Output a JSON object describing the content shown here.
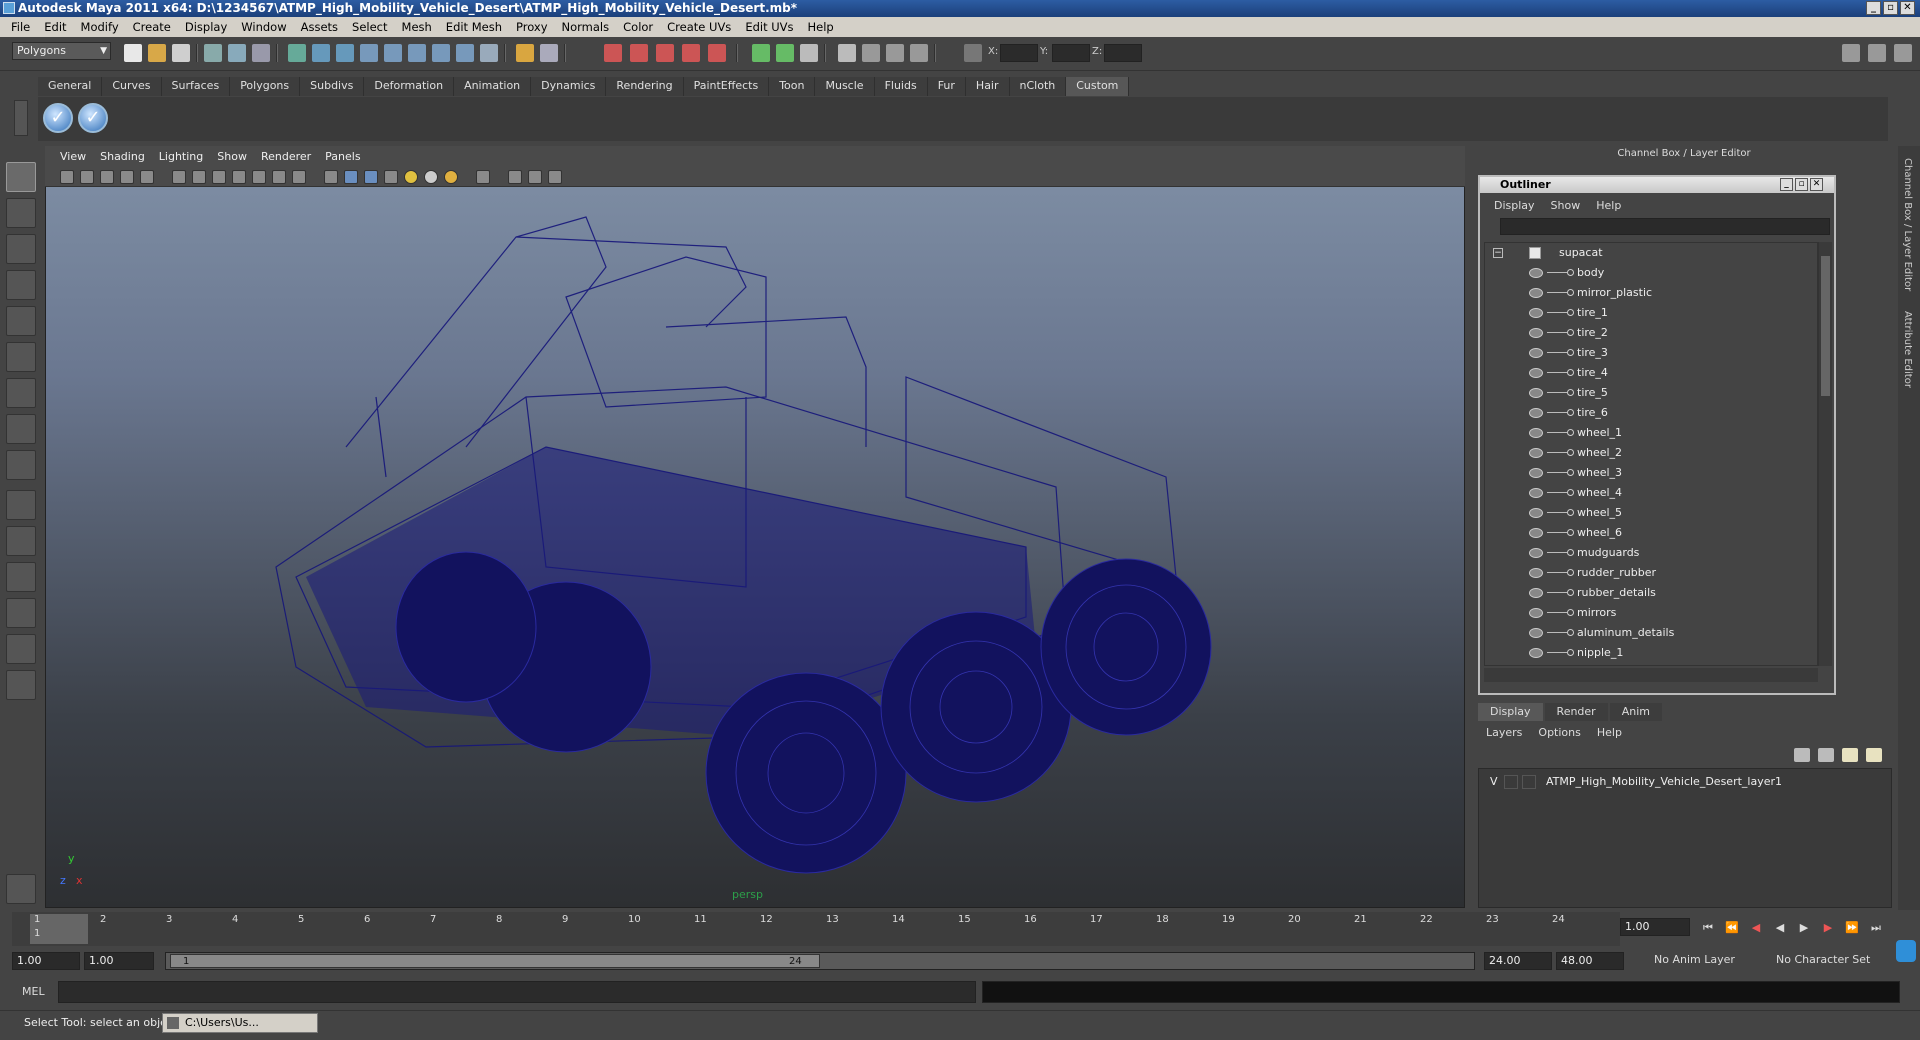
{
  "window": {
    "title": "Autodesk Maya 2011 x64: D:\\1234567\\ATMP_High_Mobility_Vehicle_Desert\\ATMP_High_Mobility_Vehicle_Desert.mb*"
  },
  "menubar": [
    "File",
    "Edit",
    "Modify",
    "Create",
    "Display",
    "Window",
    "Assets",
    "Select",
    "Mesh",
    "Edit Mesh",
    "Proxy",
    "Normals",
    "Color",
    "Create UVs",
    "Edit UVs",
    "Help"
  ],
  "toolbar": {
    "mode": "Polygons",
    "x_label": "X:",
    "y_label": "Y:",
    "z_label": "Z:"
  },
  "shelf": {
    "tabs": [
      "General",
      "Curves",
      "Surfaces",
      "Polygons",
      "Subdivs",
      "Deformation",
      "Animation",
      "Dynamics",
      "Rendering",
      "PaintEffects",
      "Toon",
      "Muscle",
      "Fluids",
      "Fur",
      "Hair",
      "nCloth",
      "Custom"
    ],
    "active": "Custom"
  },
  "viewport": {
    "menu": [
      "View",
      "Shading",
      "Lighting",
      "Show",
      "Renderer",
      "Panels"
    ],
    "camera_label": "persp",
    "axis_y": "y",
    "axis_x": "x",
    "axis_z": "z",
    "wire_color": "#1a1a7a"
  },
  "right_panel": {
    "title": "Channel Box / Layer Editor",
    "side_tabs": [
      "Channel Box / Layer Editor",
      "Attribute Editor"
    ]
  },
  "outliner": {
    "title": "Outliner",
    "menu": [
      "Display",
      "Show",
      "Help"
    ],
    "root": "supacat",
    "items": [
      "body",
      "mirror_plastic",
      "tire_1",
      "tire_2",
      "tire_3",
      "tire_4",
      "tire_5",
      "tire_6",
      "wheel_1",
      "wheel_2",
      "wheel_3",
      "wheel_4",
      "wheel_5",
      "wheel_6",
      "mudguards",
      "rudder_rubber",
      "rubber_details",
      "mirrors",
      "aluminum_details",
      "nipple_1"
    ]
  },
  "layers": {
    "tabs": [
      "Display",
      "Render",
      "Anim"
    ],
    "active_tab": "Display",
    "menu": [
      "Layers",
      "Options",
      "Help"
    ],
    "visible_flag": "V",
    "layer_name": "ATMP_High_Mobility_Vehicle_Desert_layer1"
  },
  "timeline": {
    "ticks": [
      "1",
      "2",
      "3",
      "4",
      "5",
      "6",
      "7",
      "8",
      "9",
      "10",
      "11",
      "12",
      "13",
      "14",
      "15",
      "16",
      "17",
      "18",
      "19",
      "20",
      "21",
      "22",
      "23",
      "24"
    ],
    "current_frame": "1.00",
    "current_marker": "1"
  },
  "range": {
    "start": "1.00",
    "playback_start": "1.00",
    "slider_start": "1",
    "slider_end": "24",
    "playback_end": "24.00",
    "end": "48.00",
    "anim_layer": "No Anim Layer",
    "character_set": "No Character Set"
  },
  "mel": {
    "label": "MEL"
  },
  "status": {
    "help_line": "Select Tool: select an object",
    "minimized_window": "C:\\Users\\Us..."
  }
}
